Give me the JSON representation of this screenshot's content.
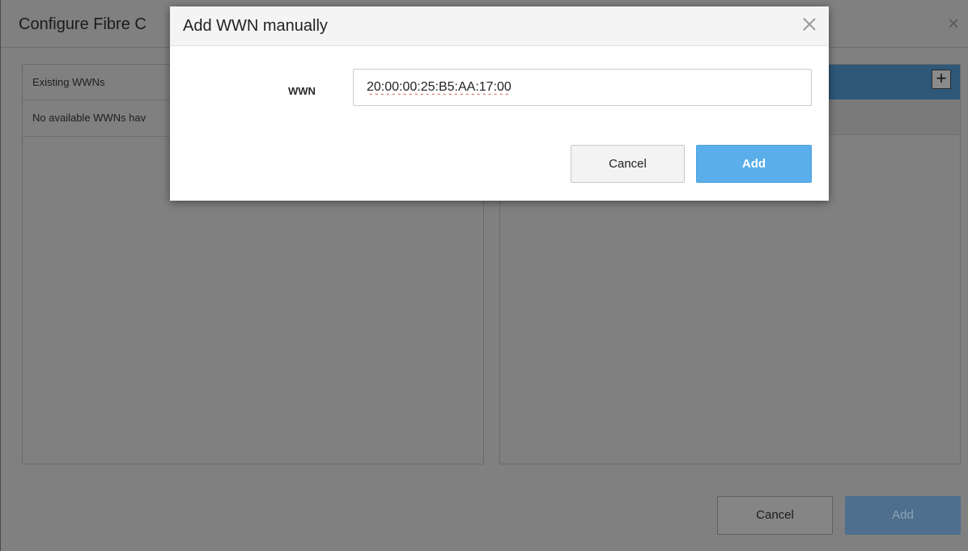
{
  "background_dialog": {
    "title": "Configure Fibre C",
    "close_glyph": "×",
    "left_panel": {
      "header": "Existing WWNs",
      "message": "No available WWNs hav"
    },
    "right_panel": {
      "add_icon": "plus-icon",
      "add_glyph": "+"
    },
    "cancel_label": "Cancel",
    "add_label": "Add"
  },
  "modal": {
    "title": "Add WWN manually",
    "close_icon": "close-icon",
    "field_label": "WWN",
    "field_value": "20:00:00:25:B5:AA:17:00",
    "cancel_label": "Cancel",
    "add_label": "Add"
  },
  "colors": {
    "primary_button": "#5aaeea",
    "header_blue": "#2f5878",
    "overlay": "#808080"
  }
}
